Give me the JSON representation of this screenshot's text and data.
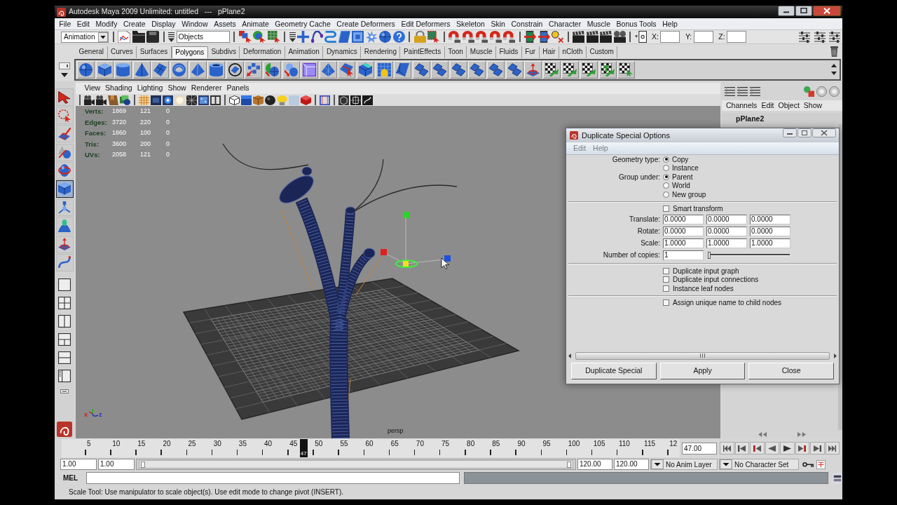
{
  "window": {
    "title": "Autodesk Maya 2009 Unlimited: untitled   ---   pPlane2"
  },
  "menu_bar": [
    "File",
    "Edit",
    "Modify",
    "Create",
    "Display",
    "Window",
    "Assets",
    "Animate",
    "Geometry Cache",
    "Create Deformers",
    "Edit Deformers",
    "Skeleton",
    "Skin",
    "Constrain",
    "Character",
    "Muscle",
    "Bonus Tools",
    "Help"
  ],
  "status_line": {
    "menu_set": "Animation",
    "selection_mask": "Objects",
    "coordinates": [
      {
        "label": "X:"
      },
      {
        "label": "Y:"
      },
      {
        "label": "Z:"
      }
    ]
  },
  "shelf": {
    "tabs": [
      {
        "label": "General",
        "selected": false
      },
      {
        "label": "Curves",
        "selected": false
      },
      {
        "label": "Surfaces",
        "selected": false
      },
      {
        "label": "Polygons",
        "selected": true
      },
      {
        "label": "Subdivs",
        "selected": false
      },
      {
        "label": "Deformation",
        "selected": false
      },
      {
        "label": "Animation",
        "selected": false
      },
      {
        "label": "Dynamics",
        "selected": false
      },
      {
        "label": "Rendering",
        "selected": false
      },
      {
        "label": "PaintEffects",
        "selected": false
      },
      {
        "label": "Toon",
        "selected": false
      },
      {
        "label": "Muscle",
        "selected": false
      },
      {
        "label": "Fluids",
        "selected": false
      },
      {
        "label": "Fur",
        "selected": false
      },
      {
        "label": "Hair",
        "selected": false
      },
      {
        "label": "nCloth",
        "selected": false
      },
      {
        "label": "Custom",
        "selected": false
      }
    ]
  },
  "toolbox": {
    "tools": [
      {
        "selected": false
      },
      {
        "selected": false
      },
      {
        "selected": false
      },
      {
        "selected": false
      },
      {
        "selected": false
      },
      {
        "selected": true
      },
      {
        "selected": false
      },
      {
        "selected": false
      },
      {
        "selected": false
      },
      {
        "selected": false
      }
    ]
  },
  "viewport": {
    "menu": [
      "View",
      "Shading",
      "Lighting",
      "Show",
      "Renderer",
      "Panels"
    ],
    "hud": [
      {
        "label": "Verts:",
        "values": [
          "1869",
          "121",
          "0"
        ]
      },
      {
        "label": "Edges:",
        "values": [
          "3720",
          "220",
          "0"
        ]
      },
      {
        "label": "Faces:",
        "values": [
          "1860",
          "100",
          "0"
        ]
      },
      {
        "label": "Tris:",
        "values": [
          "3600",
          "200",
          "0"
        ]
      },
      {
        "label": "UVs:",
        "values": [
          "2058",
          "121",
          "0"
        ]
      }
    ],
    "camera": "persp",
    "axis_labels": [
      "x",
      "z"
    ]
  },
  "channel_box": {
    "menu": [
      "Channels",
      "Edit",
      "Object",
      "Show"
    ],
    "object": "pPlane2"
  },
  "dialog": {
    "title": "Duplicate Special Options",
    "menu": [
      "Edit",
      "Help"
    ],
    "groups": [
      {
        "label": "Geometry type:",
        "options": [
          {
            "label": "Copy",
            "selected": true
          },
          {
            "label": "Instance",
            "selected": false
          }
        ]
      },
      {
        "label": "Group under:",
        "options": [
          {
            "label": "Parent",
            "selected": true
          },
          {
            "label": "World",
            "selected": false
          },
          {
            "label": "New group",
            "selected": false
          }
        ]
      }
    ],
    "smart_transform": {
      "label": "Smart transform",
      "checked": false
    },
    "transforms": [
      {
        "label": "Translate:",
        "values": [
          "0.0000",
          "0.0000",
          "0.0000"
        ]
      },
      {
        "label": "Rotate:",
        "values": [
          "0.0000",
          "0.0000",
          "0.0000"
        ]
      },
      {
        "label": "Scale:",
        "values": [
          "1.0000",
          "1.0000",
          "1.0000"
        ]
      }
    ],
    "copies": {
      "label": "Number of copies:",
      "value": "1",
      "level": 0
    },
    "options": [
      {
        "label": "Duplicate input graph",
        "checked": false
      },
      {
        "label": "Duplicate input connections",
        "checked": false
      },
      {
        "label": "Instance leaf nodes",
        "checked": false
      }
    ],
    "unique_names": {
      "label": "Assign unique name to child nodes",
      "checked": false
    },
    "buttons": [
      "Duplicate Special",
      "Apply",
      "Close"
    ]
  },
  "time_slider": {
    "ticks": [
      "5",
      "10",
      "15",
      "20",
      "25",
      "30",
      "35",
      "40",
      "45",
      "50",
      "55",
      "60",
      "65",
      "70",
      "75",
      "80",
      "85",
      "90",
      "95",
      "100",
      "105",
      "110",
      "115",
      "12"
    ],
    "current_frame": "47",
    "level": 0.387,
    "current_time": "47.00"
  },
  "range_slider": {
    "start": "1.00",
    "playback_start": "1.00",
    "level": 1,
    "playback_end": "120.00",
    "end": "120.00",
    "anim_layer": "No Anim Layer",
    "character_set": "No Character Set"
  },
  "command_line": {
    "language": "MEL"
  },
  "help_line": "Scale Tool: Use manipulator to scale object(s). Use edit mode to change pivot (INSERT)."
}
